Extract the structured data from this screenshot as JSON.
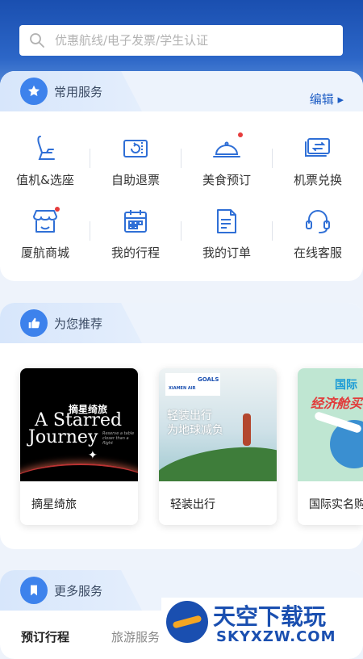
{
  "search": {
    "placeholder": "优惠航线/电子发票/学生认证"
  },
  "common": {
    "title": "常用服务",
    "edit": "编辑 ▸",
    "items": [
      {
        "label": "值机&选座"
      },
      {
        "label": "自助退票"
      },
      {
        "label": "美食预订"
      },
      {
        "label": "机票兑换"
      },
      {
        "label": "厦航商城"
      },
      {
        "label": "我的行程"
      },
      {
        "label": "我的订单"
      },
      {
        "label": "在线客服"
      }
    ]
  },
  "recommend": {
    "title": "为您推荐",
    "items": [
      {
        "label": "摘星绮旅",
        "img_title_cn": "摘星绮旅",
        "img_title_en_1": "A Starred",
        "img_title_en_2": "Journey",
        "img_note": "Reserve a table closer than a flight"
      },
      {
        "label": "轻装出行",
        "img_line1": "轻装出行",
        "img_line2": "为地球减负",
        "img_logo": "XIAMEN AIR",
        "img_goals": "GOALS"
      },
      {
        "label": "国际实名购",
        "img_top": "国际",
        "img_main": "经济舱买"
      }
    ]
  },
  "more": {
    "title": "更多服务",
    "tabs": [
      "预订行程",
      "旅游服务"
    ]
  },
  "watermark": {
    "cn": "天空下载玩",
    "url": "SKYXZW.COM"
  },
  "colors": {
    "accent": "#1e5dc4",
    "icon_blue": "#2f6fd6",
    "badge": "#e63c3c"
  }
}
